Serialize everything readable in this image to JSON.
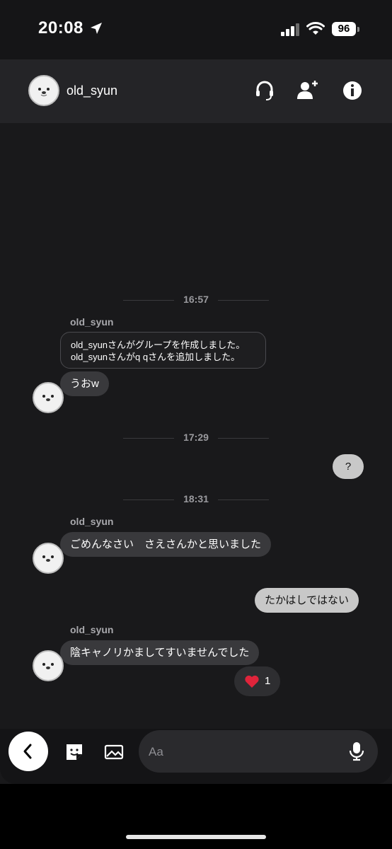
{
  "status_bar": {
    "time": "20:08",
    "battery": "96"
  },
  "header": {
    "name": "old_syun"
  },
  "messages": {
    "time1": "16:57",
    "sender1": "old_syun",
    "system_line1": "old_syunさんがグループを作成しました。",
    "system_line2": "old_syunさんがq qさんを追加しました。",
    "msg1": "うおw",
    "time2": "17:29",
    "msg_right1": "?",
    "time3": "18:31",
    "sender2": "old_syun",
    "msg2": "ごめんなさい　さえさんかと思いました",
    "msg_right2": "たかはしではない",
    "sender3": "old_syun",
    "msg3": "陰キャノリかましてすいませんでした",
    "reaction_count": "1"
  },
  "input": {
    "placeholder": "Aa"
  },
  "icons": {
    "location": "location-arrow-icon",
    "signal": "signal-icon",
    "wifi": "wifi-icon",
    "headset": "headset-icon",
    "add_user": "add-user-icon",
    "info": "info-icon",
    "back": "chevron-left-icon",
    "sticker": "sticker-icon",
    "image": "image-icon",
    "mic": "microphone-icon",
    "heart": "heart-icon"
  }
}
